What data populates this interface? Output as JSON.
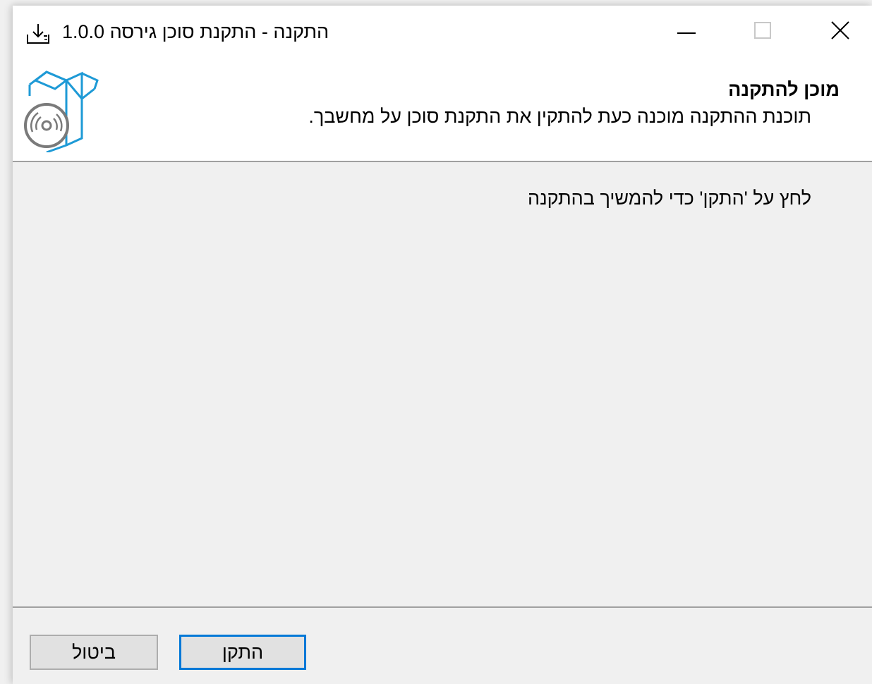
{
  "window": {
    "title": "התקנה - התקנת סוכן גירסה 1.0.0",
    "controls": {
      "minimize_icon": "minimize-icon",
      "maximize_icon": "maximize-icon",
      "close_icon": "close-icon"
    }
  },
  "header": {
    "title": "מוכן להתקנה",
    "subtitle": "תוכנת ההתקנה מוכנה כעת להתקין את התקנת סוכן על מחשבך.",
    "icon": "installer-box-icon"
  },
  "content": {
    "instruction": "לחץ על 'התקן' כדי להמשיך בהתקנה"
  },
  "buttons": {
    "install_label": "התקן",
    "cancel_label": "ביטול"
  },
  "colors": {
    "accent": "#0078d7",
    "icon_blue": "#1e9ad6",
    "icon_gray": "#7a7a7a"
  }
}
